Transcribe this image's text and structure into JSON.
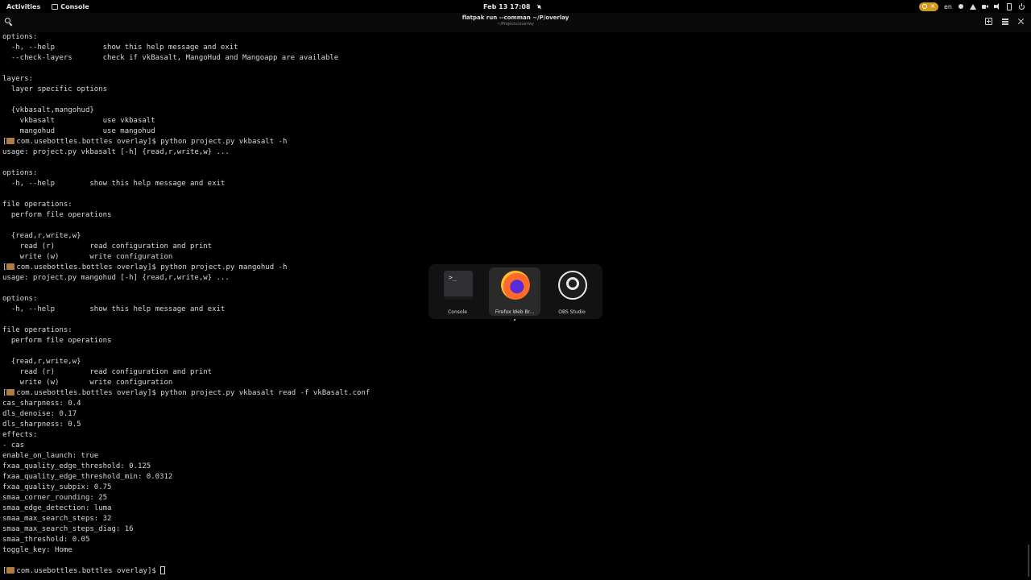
{
  "topbar": {
    "activities": "Activities",
    "app_name": "Console",
    "datetime": "Feb 13  17:08",
    "language": "en"
  },
  "terminal_header": {
    "title": "flatpak run --comman ~/P/overlay",
    "subtitle": "~/Projects/overlay"
  },
  "terminal_lines": [
    "options:",
    "  -h, --help           show this help message and exit",
    "  --check-layers       check if vkBasalt, MangoHud and Mangoapp are available",
    "",
    "layers:",
    "  layer specific options",
    "",
    "  {vkbasalt,mangohud}",
    "    vkbasalt           use vkbasalt",
    "    mangohud           use mangohud",
    "[PROMPT] com.usebottles.bottles overlay]$ python project.py vkbasalt -h",
    "usage: project.py vkbasalt [-h] {read,r,write,w} ...",
    "",
    "options:",
    "  -h, --help        show this help message and exit",
    "",
    "file operations:",
    "  perform file operations",
    "",
    "  {read,r,write,w}",
    "    read (r)        read configuration and print",
    "    write (w)       write configuration",
    "[PROMPT] com.usebottles.bottles overlay]$ python project.py mangohud -h",
    "usage: project.py mangohud [-h] {read,r,write,w} ...",
    "",
    "options:",
    "  -h, --help        show this help message and exit",
    "",
    "file operations:",
    "  perform file operations",
    "",
    "  {read,r,write,w}",
    "    read (r)        read configuration and print",
    "    write (w)       write configuration",
    "[PROMPT] com.usebottles.bottles overlay]$ python project.py vkbasalt read -f vkBasalt.conf",
    "cas_sharpness: 0.4",
    "dls_denoise: 0.17",
    "dls_sharpness: 0.5",
    "effects:",
    "- cas",
    "enable_on_launch: true",
    "fxaa_quality_edge_threshold: 0.125",
    "fxaa_quality_edge_threshold_min: 0.0312",
    "fxaa_quality_subpix: 0.75",
    "smaa_corner_rounding: 25",
    "smaa_edge_detection: luma",
    "smaa_max_search_steps: 32",
    "smaa_max_search_steps_diag: 16",
    "smaa_threshold: 0.05",
    "toggle_key: Home",
    "",
    "[PROMPT] com.usebottles.bottles overlay]$ [CURSOR]"
  ],
  "switcher": {
    "items": [
      {
        "label": "Console",
        "icon": "terminal-icon"
      },
      {
        "label": "Firefox Web Br...",
        "icon": "firefox-icon"
      },
      {
        "label": "OBS Studio",
        "icon": "obs-icon"
      }
    ]
  },
  "colors": {
    "background": "#000000",
    "text": "#d8d8d8",
    "prompt_icon": "#b07a40",
    "accent_pill": "#d19a1c"
  }
}
